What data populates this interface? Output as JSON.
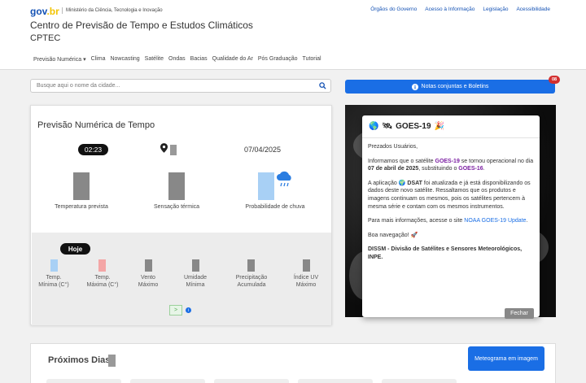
{
  "header": {
    "logo_gov": "gov",
    "logo_br": ".br",
    "ministry": "Ministério da Ciência, Tecnologia e Inovação",
    "top_links": [
      "Órgãos do Governo",
      "Acesso à Informação",
      "Legislação",
      "Acessibilidade"
    ],
    "title": "Centro de Previsão de Tempo e Estudos Climáticos",
    "subtitle": "CPTEC"
  },
  "nav": {
    "items": [
      "Previsão Numérica ▾",
      "Clima",
      "Nowcasting",
      "Satélite",
      "Ondas",
      "Bacias",
      "Qualidade do Ar",
      "Pós Graduação",
      "Tutorial"
    ]
  },
  "search": {
    "placeholder": "Busque aqui o nome da cidade..."
  },
  "notes": {
    "label": "Notas conjuntas e Boletins",
    "badge": "08"
  },
  "forecast": {
    "title": "Previsão Numérica de Tempo",
    "time": "02:23",
    "date": "07/04/2025",
    "labels": [
      "Temperatura prevista",
      "Sensação térmica",
      "Probabilidade de chuva"
    ],
    "today_label": "Hoje",
    "day_labels": [
      "Temp.\nMínima (C°)",
      "Temp.\nMáxima (C°)",
      "Vento\nMáximo",
      "Umidade\nMínima",
      "Precipitação\nAcumulada",
      "Índice UV\nMáximo"
    ],
    "next_btn": ">",
    "info": "i"
  },
  "modal": {
    "title": "GOES-19",
    "greeting": "Prezados Usuários,",
    "p1_a": "Informamos que o satélite ",
    "p1_goes19": "GOES-19",
    "p1_b": " se tornou operacional no dia ",
    "p1_date": "07 de abril de 2025",
    "p1_c": ", substituindo o ",
    "p1_goes16": "GOES-16",
    "p1_d": ".",
    "p2_a": "A aplicação ",
    "p2_dsat": "DSAT",
    "p2_b": " foi atualizada e já está disponibilizando os dados deste novo satélite. Ressaltamos que os produtos e imagens continuam os mesmos, pois os satélites pertencem à mesma série e contam com os mesmos instrumentos.",
    "p3_a": "Para mais informações, acesse o site ",
    "p3_link": "NOAA GOES-19 Update",
    "p3_b": ".",
    "p4": "Boa navegação! 🚀",
    "sign": "DISSM - Divisão de Satélites e Sensores Meteorológicos, INPE.",
    "close": "Fechar"
  },
  "next_days": {
    "title": "Próximos Dias:",
    "meteo_btn": "Meteograma em imagem"
  },
  "colors": {
    "primary": "#1a6ee5",
    "badge": "#d32f2f",
    "goes19": "#7b1fa2",
    "goes16": "#1351b4",
    "rain_bar": "#a8d0f5",
    "min_temp": "#a8d0f5",
    "max_temp": "#f4a6a6"
  }
}
